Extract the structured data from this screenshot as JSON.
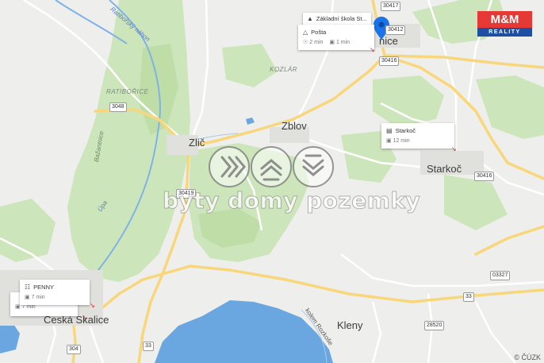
{
  "places": {
    "zblov": "Zblov",
    "zlic": "Zlič",
    "starkoc": "Starkoč",
    "kleny": "Kleny",
    "ceska_skalice": "Česká Skalice",
    "town_ne": "nice",
    "kozlar": "KOZLÁR",
    "ratiborice": "RATIBOŘICE"
  },
  "rivers": {
    "ratiborsky": "Ratibořský náhon",
    "upa": "Úpa",
    "bazantnice": "Bažantnice",
    "rozkose": "kolem Rozkoše"
  },
  "road_numbers": {
    "r30417": "30417",
    "r30412": "30412",
    "r30416a": "30416",
    "r3048": "3048",
    "r30416b": "30416",
    "r30419": "30419",
    "r03327": "03327",
    "r33a": "33",
    "r33b": "33",
    "r28520": "28520",
    "r304": "304"
  },
  "poi_cards": {
    "skola": {
      "label": "Základní škola St..."
    },
    "posta": {
      "label": "Pošta",
      "walk": "2 min",
      "car": "1 min"
    },
    "starkoc_bus": {
      "label": "Starkoč",
      "car": "12 min"
    },
    "penny": {
      "label": "PENNY",
      "car": "7 min"
    },
    "second_card": {
      "car": "7 min"
    }
  },
  "logo": {
    "top": "M&M",
    "bottom": "REALITY"
  },
  "watermark": {
    "text": "byty domy pozemky"
  },
  "copyright": "© ČÚZK",
  "colors": {
    "land": "#eeeeec",
    "forest": "#c9e3b4",
    "water": "#6aa7e0",
    "major_road": "#f8d77c",
    "marker": "#1a73e8",
    "logo_red": "#e53935",
    "logo_blue": "#1d4fa3"
  }
}
